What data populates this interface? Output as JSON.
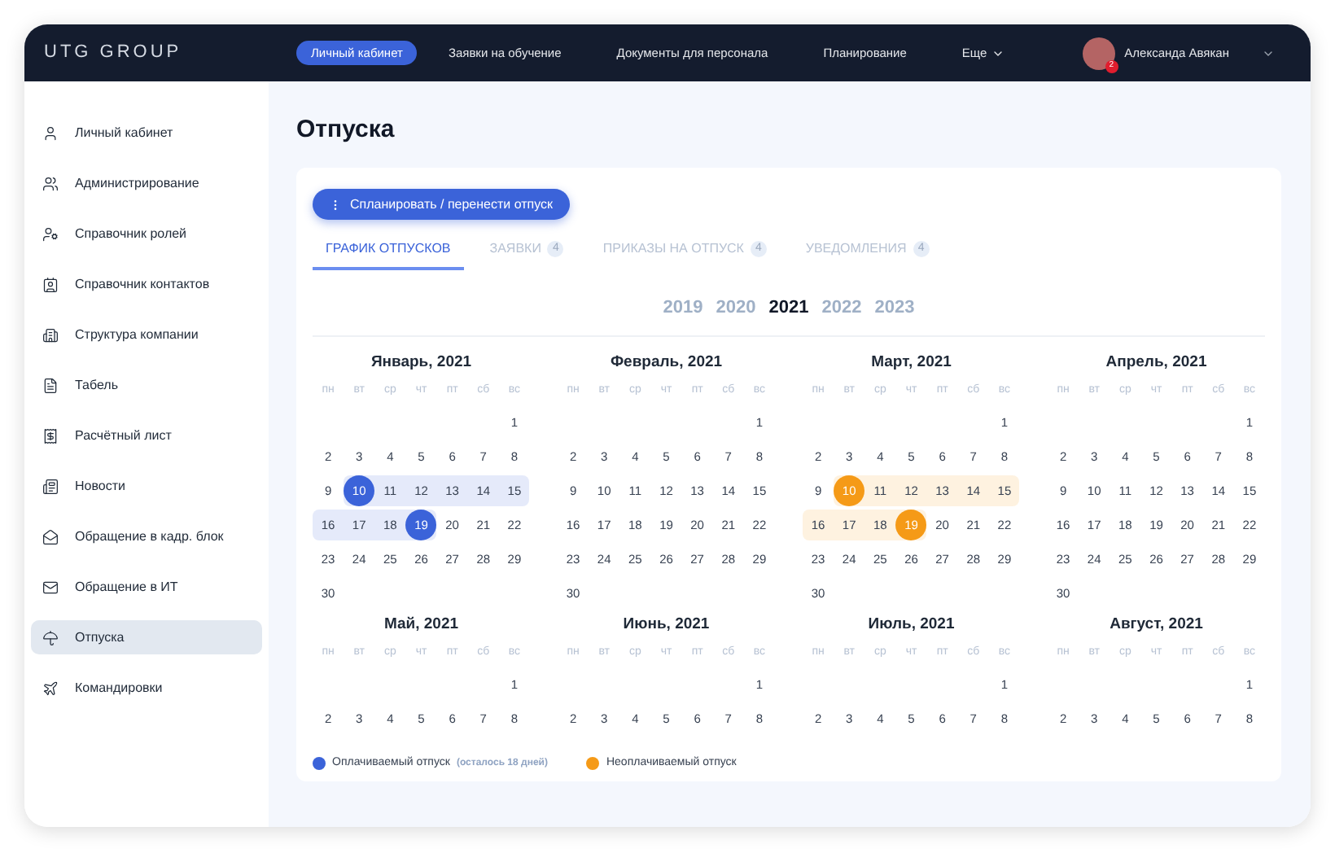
{
  "brand": "UTG GROUP",
  "nav": [
    {
      "label": "Личный кабинет",
      "selected": true,
      "kind": "link"
    },
    {
      "label": "Заявки на обучение",
      "selected": false,
      "kind": "link"
    },
    {
      "label": "Документы для персонала",
      "selected": false,
      "kind": "link"
    },
    {
      "label": "Планирование",
      "selected": false,
      "kind": "link"
    },
    {
      "label": "Еще",
      "selected": false,
      "kind": "dropdown"
    }
  ],
  "user": {
    "name": "Александа Авякан",
    "notification_count": "2"
  },
  "sidebar": {
    "items": [
      {
        "label": "Личный кабинет",
        "selected": false
      },
      {
        "label": "Администрирование",
        "selected": false
      },
      {
        "label": "Справочник ролей",
        "selected": false
      },
      {
        "label": "Справочник контактов",
        "selected": false
      },
      {
        "label": "Структура компании",
        "selected": false
      },
      {
        "label": "Табель",
        "selected": false
      },
      {
        "label": "Расчётный лист",
        "selected": false
      },
      {
        "label": "Новости",
        "selected": false
      },
      {
        "label": "Обращение в кадр. блок",
        "selected": false
      },
      {
        "label": "Обращение в ИТ",
        "selected": false
      },
      {
        "label": "Отпуска",
        "selected": true
      },
      {
        "label": "Командировки",
        "selected": false
      }
    ]
  },
  "page_title": "Отпуска",
  "plan_button": "Спланировать / перенести отпуск",
  "tabs": [
    {
      "label": "ГРАФИК ОТПУСКОВ",
      "selected": true
    },
    {
      "label": "ЗАЯВКИ",
      "count": "4",
      "selected": false
    },
    {
      "label": "ПРИКАЗЫ НА ОТПУСК",
      "count": "4",
      "selected": false
    },
    {
      "label": "УВЕДОМЛЕНИЯ",
      "count": "4",
      "selected": false
    }
  ],
  "years": [
    {
      "label": "2019",
      "selected": false
    },
    {
      "label": "2020",
      "selected": false
    },
    {
      "label": "2021",
      "selected": true
    },
    {
      "label": "2022",
      "selected": false
    },
    {
      "label": "2023",
      "selected": false
    }
  ],
  "months": [
    {
      "title": "Январь, 2021",
      "color": "#3b63d9",
      "weekdays": [
        "пн",
        "вт",
        "ср",
        "чт",
        "пт",
        "сб",
        "вс"
      ],
      "weeks": [
        {
          "kind": "lead",
          "days": [
            "1"
          ]
        },
        {
          "kind": "row",
          "days": [
            "2",
            "3",
            "4",
            "5",
            "6",
            "7",
            "8"
          ]
        },
        {
          "kind": "row",
          "days": [
            "9",
            {
              "day": "10",
              "kind": "edge"
            },
            {
              "day": "11",
              "kind": "range"
            },
            {
              "day": "12",
              "kind": "range"
            },
            {
              "day": "13",
              "kind": "range"
            },
            {
              "day": "14",
              "kind": "range"
            },
            {
              "day": "15",
              "kind": "range"
            }
          ]
        },
        {
          "kind": "row",
          "days": [
            {
              "day": "16",
              "kind": "range"
            },
            {
              "day": "17",
              "kind": "range"
            },
            {
              "day": "18",
              "kind": "range"
            },
            {
              "day": "19",
              "kind": "edge"
            },
            "20",
            "21",
            "22"
          ]
        },
        {
          "kind": "row",
          "days": [
            "23",
            "24",
            "25",
            "26",
            "27",
            "28",
            "29"
          ]
        },
        {
          "kind": "row",
          "days": [
            "30"
          ]
        }
      ]
    },
    {
      "title": "Февраль, 2021",
      "weekdays": [
        "пн",
        "вт",
        "ср",
        "чт",
        "пт",
        "сб",
        "вс"
      ],
      "weeks": [
        {
          "kind": "lead",
          "days": [
            "1"
          ]
        },
        {
          "kind": "row",
          "days": [
            "2",
            "3",
            "4",
            "5",
            "6",
            "7",
            "8"
          ]
        },
        {
          "kind": "row",
          "days": [
            "9",
            "10",
            "11",
            "12",
            "13",
            "14",
            "15"
          ]
        },
        {
          "kind": "row",
          "days": [
            "16",
            "17",
            "18",
            "19",
            "20",
            "21",
            "22"
          ]
        },
        {
          "kind": "row",
          "days": [
            "23",
            "24",
            "25",
            "26",
            "27",
            "28",
            "29"
          ]
        },
        {
          "kind": "row",
          "days": [
            "30"
          ]
        }
      ]
    },
    {
      "title": "Март, 2021",
      "color": "#f59a17",
      "weekdays": [
        "пн",
        "вт",
        "ср",
        "чт",
        "пт",
        "сб",
        "вс"
      ],
      "weeks": [
        {
          "kind": "lead",
          "days": [
            "1"
          ]
        },
        {
          "kind": "row",
          "days": [
            "2",
            "3",
            "4",
            "5",
            "6",
            "7",
            "8"
          ]
        },
        {
          "kind": "row",
          "days": [
            "9",
            {
              "day": "10",
              "kind": "edge"
            },
            {
              "day": "11",
              "kind": "range"
            },
            {
              "day": "12",
              "kind": "range"
            },
            {
              "day": "13",
              "kind": "range"
            },
            {
              "day": "14",
              "kind": "range"
            },
            {
              "day": "15",
              "kind": "range"
            }
          ]
        },
        {
          "kind": "row",
          "days": [
            {
              "day": "16",
              "kind": "range"
            },
            {
              "day": "17",
              "kind": "range"
            },
            {
              "day": "18",
              "kind": "range"
            },
            {
              "day": "19",
              "kind": "edge"
            },
            "20",
            "21",
            "22"
          ]
        },
        {
          "kind": "row",
          "days": [
            "23",
            "24",
            "25",
            "26",
            "27",
            "28",
            "29"
          ]
        },
        {
          "kind": "row",
          "days": [
            "30"
          ]
        }
      ]
    },
    {
      "title": "Апрель, 2021",
      "weekdays": [
        "пн",
        "вт",
        "ср",
        "чт",
        "пт",
        "сб",
        "вс"
      ],
      "weeks": [
        {
          "kind": "lead",
          "days": [
            "1"
          ]
        },
        {
          "kind": "row",
          "days": [
            "2",
            "3",
            "4",
            "5",
            "6",
            "7",
            "8"
          ]
        },
        {
          "kind": "row",
          "days": [
            "9",
            "10",
            "11",
            "12",
            "13",
            "14",
            "15"
          ]
        },
        {
          "kind": "row",
          "days": [
            "16",
            "17",
            "18",
            "19",
            "20",
            "21",
            "22"
          ]
        },
        {
          "kind": "row",
          "days": [
            "23",
            "24",
            "25",
            "26",
            "27",
            "28",
            "29"
          ]
        },
        {
          "kind": "row",
          "days": [
            "30"
          ]
        }
      ]
    },
    {
      "title": "Май, 2021",
      "weekdays": [
        "пн",
        "вт",
        "ср",
        "чт",
        "пт",
        "сб",
        "вс"
      ],
      "weeks": [
        {
          "kind": "lead",
          "days": [
            "1"
          ]
        },
        {
          "kind": "row",
          "days": [
            "2",
            "3",
            "4",
            "5",
            "6",
            "7",
            "8"
          ]
        }
      ]
    },
    {
      "title": "Июнь, 2021",
      "weekdays": [
        "пн",
        "вт",
        "ср",
        "чт",
        "пт",
        "сб",
        "вс"
      ],
      "weeks": [
        {
          "kind": "lead",
          "days": [
            "1"
          ]
        },
        {
          "kind": "row",
          "days": [
            "2",
            "3",
            "4",
            "5",
            "6",
            "7",
            "8"
          ]
        }
      ]
    },
    {
      "title": "Июль, 2021",
      "weekdays": [
        "пн",
        "вт",
        "ср",
        "чт",
        "пт",
        "сб",
        "вс"
      ],
      "weeks": [
        {
          "kind": "lead",
          "days": [
            "1"
          ]
        },
        {
          "kind": "row",
          "days": [
            "2",
            "3",
            "4",
            "5",
            "6",
            "7",
            "8"
          ]
        }
      ]
    },
    {
      "title": "Август, 2021",
      "weekdays": [
        "пн",
        "вт",
        "ср",
        "чт",
        "пт",
        "сб",
        "вс"
      ],
      "weeks": [
        {
          "kind": "lead",
          "days": [
            "1"
          ]
        },
        {
          "kind": "row",
          "days": [
            "2",
            "3",
            "4",
            "5",
            "6",
            "7",
            "8"
          ]
        }
      ]
    }
  ],
  "legend": [
    {
      "label": "Оплачиваемый отпуск",
      "note": "(осталось 18 дней)",
      "color": "#3b63d9"
    },
    {
      "label": "Неоплачиваемый отпуск",
      "color": "#f59a17"
    }
  ]
}
